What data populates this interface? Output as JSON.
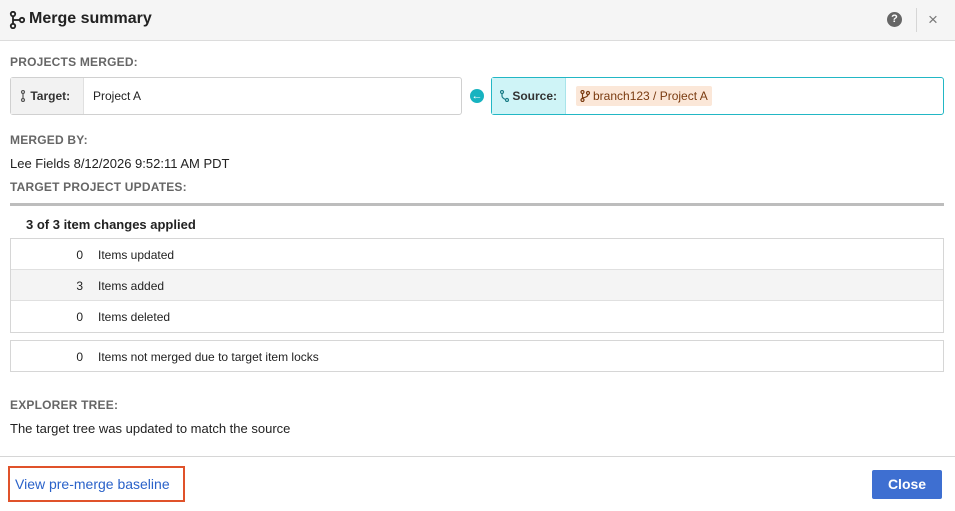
{
  "dialog": {
    "title": "Merge summary",
    "help_icon": "?",
    "close_icon": "×"
  },
  "projects": {
    "section_label": "PROJECTS MERGED:",
    "target_label": "Target:",
    "target_value": "Project A",
    "source_label": "Source:",
    "source_value": "branch123 / Project A",
    "arrow_icon": "←"
  },
  "merged_by": {
    "section_label": "MERGED BY:",
    "value": "Lee Fields 8/12/2026 9:52:11 AM PDT"
  },
  "updates": {
    "section_label": "TARGET PROJECT UPDATES:",
    "summary": "3 of 3 item changes applied",
    "rows": [
      {
        "count": "0",
        "label": "Items updated"
      },
      {
        "count": "3",
        "label": "Items added"
      },
      {
        "count": "0",
        "label": "Items deleted"
      }
    ],
    "locks": {
      "count": "0",
      "label": "Items not merged due to target item locks"
    }
  },
  "explorer": {
    "section_label": "EXPLORER TREE:",
    "value": "The target tree was updated to match the source"
  },
  "footer": {
    "baseline_link": "View pre-merge baseline",
    "close_button": "Close"
  },
  "colors": {
    "accent_teal": "#17b3c0",
    "source_chip_bg": "#fbe7d8",
    "primary_button": "#3e6fd1",
    "link": "#2a62c9",
    "highlight_border": "#e0522a"
  }
}
